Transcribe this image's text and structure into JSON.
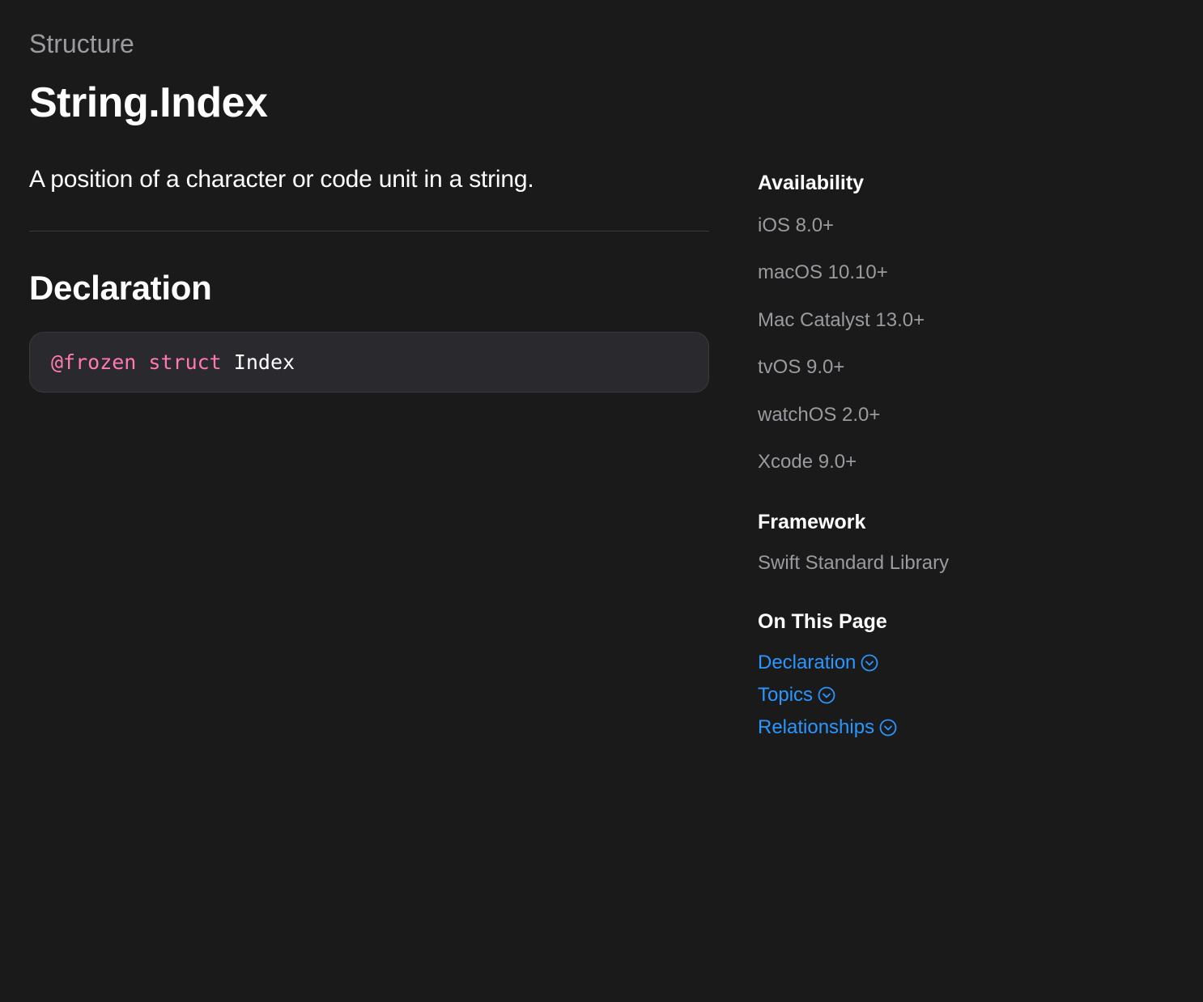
{
  "eyebrow": "Structure",
  "title": "String.Index",
  "description": "A position of a character or code unit in a string.",
  "declaration": {
    "heading": "Declaration",
    "code": {
      "attribute": "@frozen",
      "keyword": "struct",
      "identifier": "Index"
    }
  },
  "sidebar": {
    "availability": {
      "heading": "Availability",
      "items": [
        "iOS 8.0+",
        "macOS 10.10+",
        "Mac Catalyst 13.0+",
        "tvOS 9.0+",
        "watchOS 2.0+",
        "Xcode 9.0+"
      ]
    },
    "framework": {
      "heading": "Framework",
      "name": "Swift Standard Library"
    },
    "onThisPage": {
      "heading": "On This Page",
      "items": [
        "Declaration",
        "Topics",
        "Relationships"
      ]
    }
  }
}
